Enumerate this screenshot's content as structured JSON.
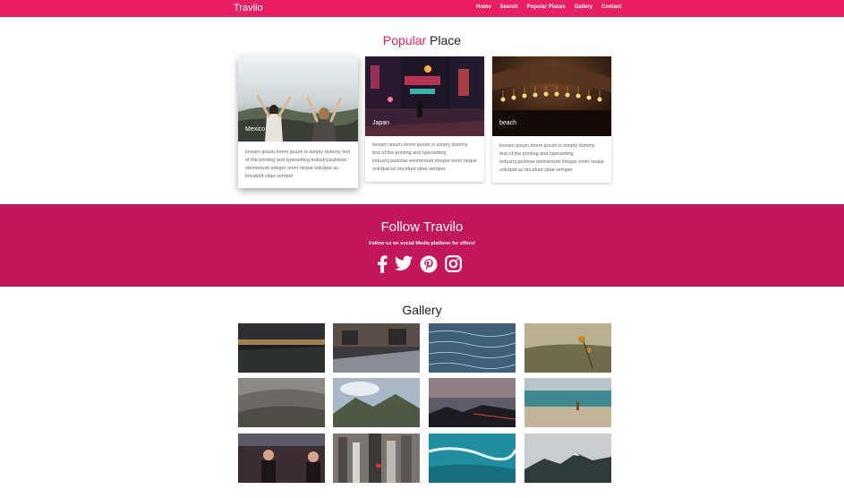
{
  "nav": {
    "brand": "Travilo",
    "links": [
      "Home",
      "Search",
      "Popular Places",
      "Gallery",
      "Contact"
    ]
  },
  "popular": {
    "title_accent": "Popular",
    "title_rest": " Place",
    "cards": [
      {
        "caption": "Mexico",
        "text": "loream ipsum,lorem ipsum is simply dummy text of the printing and typesetting industry,pulvinar elementum integer enim neque volutpat ac tincidunt vitae semper"
      },
      {
        "caption": "Japan",
        "text": "loream ipsum,lorem ipsum is simply dummy text of the printing and typesetting industry,pulvinar elementum integer enim neque volutpat ac tincidunt vitae semper"
      },
      {
        "caption": "beach",
        "text": "loream ipsum,lorem ipsum is simply dummy text of the printing and typesetting industry,pulvinar elementum integer enim neque volutpat ac tincidunt vitae semper"
      }
    ]
  },
  "follow": {
    "title": "Follow Travilo",
    "subtitle": "Follow us on social Media platform for offers!",
    "icons": [
      "facebook-icon",
      "twitter-icon",
      "pinterest-icon",
      "instagram-icon"
    ]
  },
  "gallery": {
    "title": "Gallery"
  },
  "colors": {
    "brand": "#e91e63",
    "follow_bg": "#c2185b"
  }
}
